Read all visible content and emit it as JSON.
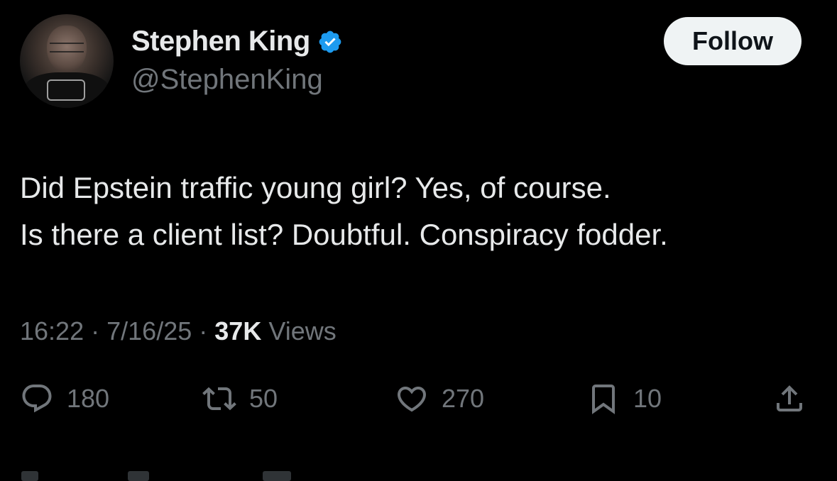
{
  "author": {
    "name": "Stephen King",
    "handle": "@StephenKing",
    "verified_icon": "verified-badge-icon",
    "follow_label": "Follow"
  },
  "tweet": {
    "lines": [
      "Did Epstein traffic young girl? Yes, of course.",
      "Is there a client list? Doubtful. Conspiracy fodder."
    ],
    "time": "16:22",
    "separator": "·",
    "date": "7/16/25",
    "views_count": "37K",
    "views_label": "Views"
  },
  "actions": {
    "replies": "180",
    "retweets": "50",
    "likes": "270",
    "bookmarks": "10"
  },
  "colors": {
    "background": "#000000",
    "text": "#e7e9ea",
    "secondary": "#71767b",
    "verified": "#1d9bf0",
    "follow_bg": "#eff3f4"
  }
}
